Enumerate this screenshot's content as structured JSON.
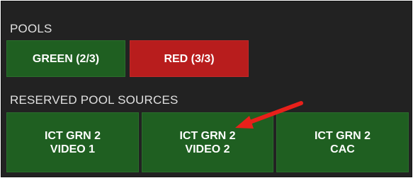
{
  "pools": {
    "label": "POOLS",
    "items": [
      {
        "label": "GREEN (2/3)",
        "color": "#1f5f21"
      },
      {
        "label": "RED (3/3)",
        "color": "#b81d1d"
      }
    ]
  },
  "reserved": {
    "label": "RESERVED POOL SOURCES",
    "items": [
      {
        "line1": "ICT GRN 2",
        "line2": "VIDEO 1"
      },
      {
        "line1": "ICT GRN 2",
        "line2": "VIDEO 2"
      },
      {
        "line1": "ICT GRN 2",
        "line2": "CAC"
      }
    ]
  },
  "annotation": {
    "arrow_color": "#e8201a",
    "icon": "red-arrow-icon"
  }
}
